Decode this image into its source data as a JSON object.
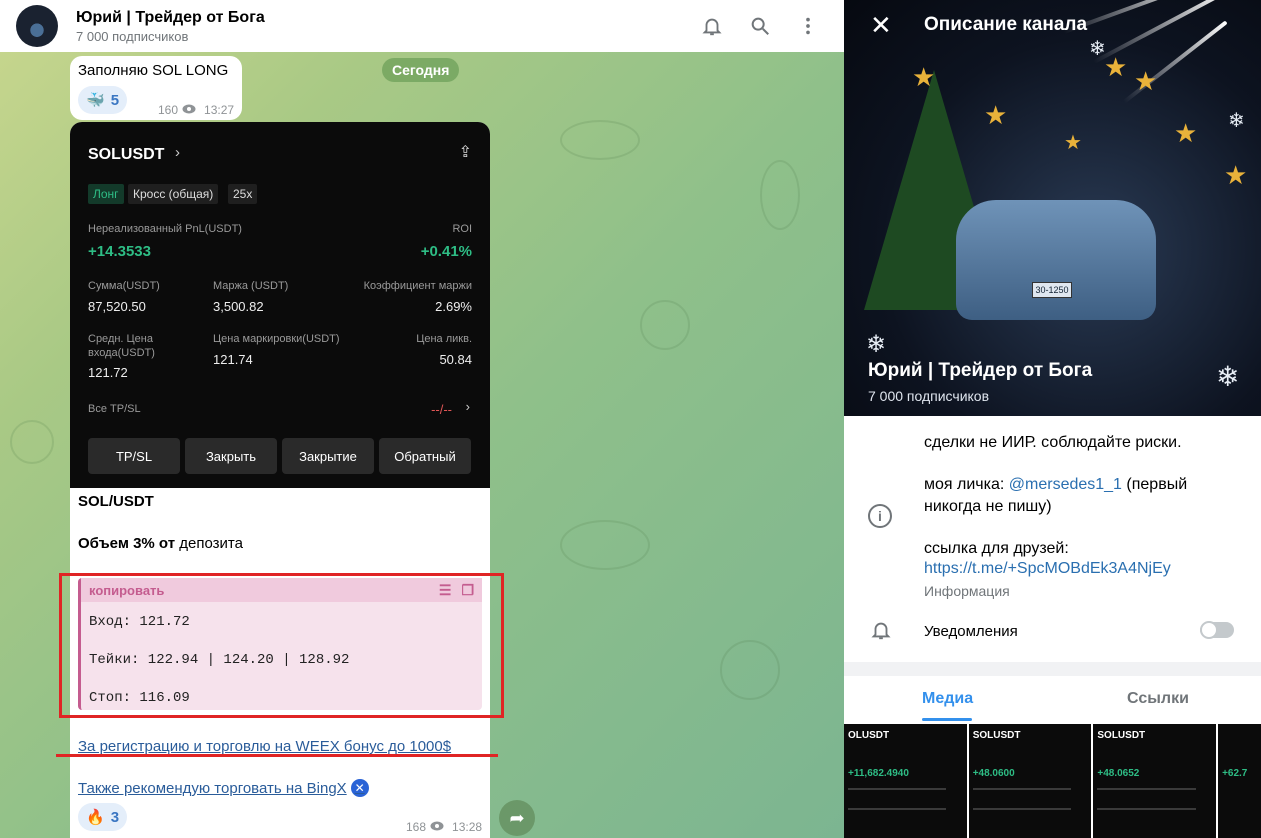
{
  "channel": {
    "name": "Юрий | Трейдер от Бога",
    "subscribers": "7 000 подписчиков"
  },
  "message1": {
    "text": "Заполняю SOL LONG",
    "reaction_emoji": "🐳",
    "reaction_count": "5",
    "views": "160",
    "time": "13:27"
  },
  "date_badge": "Сегодня",
  "screenshot": {
    "pair": "SOLUSDT",
    "tag_long": "Лонг",
    "tag_cross": "Кросс (общая)",
    "tag_lev": "25x",
    "pnl_label": "Нереализованный PnL(USDT)",
    "pnl_value": "+14.3533",
    "roi_label": "ROI",
    "roi_value": "+0.41%",
    "amount_label": "Сумма(USDT)",
    "amount_value": "87,520.50",
    "margin_label": "Маржа (USDT)",
    "margin_value": "3,500.82",
    "coef_label": "Коэффициент маржи",
    "coef_value": "2.69%",
    "entry_label_1": "Средн. Цена",
    "entry_label_2": "входа(USDT)",
    "entry_value": "121.72",
    "mark_label": "Цена маркировки(USDT)",
    "mark_value": "121.74",
    "liq_label": "Цена ликв.",
    "liq_value": "50.84",
    "tpsl_label": "Все TP/SL",
    "tpsl_value": "--/--",
    "buttons": [
      "TP/SL",
      "Закрыть",
      "Закрытие",
      "Обратный"
    ]
  },
  "message2": {
    "pair_line": "SOL/USDT",
    "volume_bold": "Объем 3%",
    "volume_mid": " от ",
    "volume_rest": "депозита",
    "code_header": "копировать",
    "entry_line": "Вход: 121.72",
    "takes_line": "Тейки: 122.94 | 124.20 | 128.92",
    "stop_line": "Стоп: 116.09",
    "link1": "За регистрацию и торговлю на WEEX бонус до 1000$",
    "link2": "Также рекомендую торговать на BingX",
    "reaction_emoji": "🔥",
    "reaction_count": "3",
    "views": "168",
    "time": "13:28"
  },
  "panel": {
    "title": "Описание канала",
    "channel_name": "Юрий | Трейдер от Бога",
    "channel_subs": "7 000 подписчиков",
    "plate": "30-1250",
    "desc_line1": "сделки не ИИР. соблюдайте риски.",
    "desc_line2a": "моя личка: ",
    "desc_handle": "@mersedes1_1",
    "desc_line2b": " (первый",
    "desc_line3": "никогда не пишу)",
    "desc_line4": "ссылка для друзей:",
    "desc_link": "https://t.me/+SpcMOBdEk3A4NjEy",
    "info_label": "Информация",
    "notifications": "Уведомления",
    "tab_media": "Медиа",
    "tab_links": "Ссылки",
    "thumbs": [
      {
        "pair": "OLUSDT",
        "value": "+11,682.4940"
      },
      {
        "pair": "SOLUSDT",
        "value": "+48.0600"
      },
      {
        "pair": "SOLUSDT",
        "value": "+48.0652"
      },
      {
        "pair": "",
        "value": "+62.7"
      }
    ]
  },
  "colors": {
    "accent": "#3390ec",
    "profit": "#2ebd85",
    "highlight": "#e02424",
    "code_bg": "#f6e2ec"
  }
}
